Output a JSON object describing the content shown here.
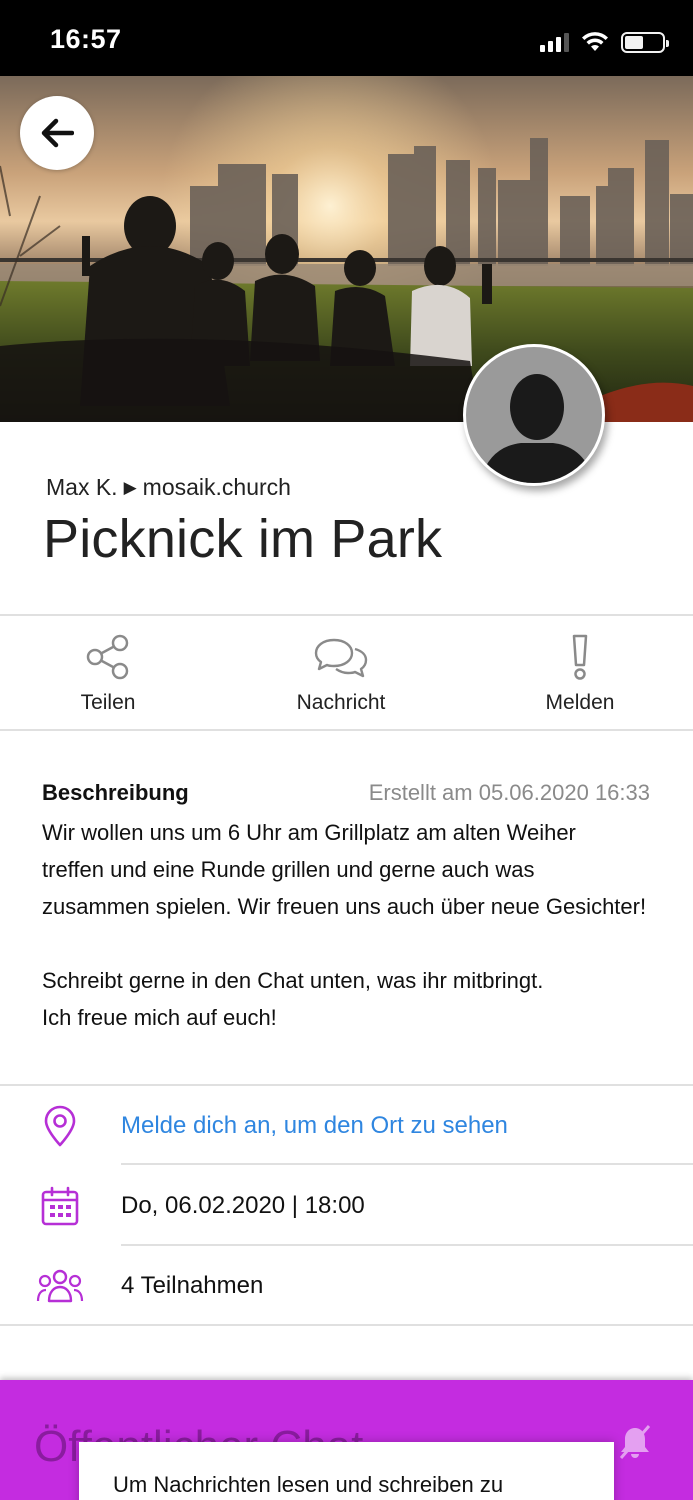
{
  "status_bar": {
    "time": "16:57"
  },
  "event": {
    "author": "Max K.",
    "community": "mosaik.church",
    "title": "Picknick im Park"
  },
  "actions": [
    {
      "label": "Teilen",
      "icon": "share-icon"
    },
    {
      "label": "Nachricht",
      "icon": "chat-bubbles-icon"
    },
    {
      "label": "Melden",
      "icon": "exclamation-icon"
    }
  ],
  "description": {
    "heading": "Beschreibung",
    "created": "Erstellt am 05.06.2020 16:33",
    "lines": [
      "Wir wollen uns um 6 Uhr am Grillplatz am alten Weiher",
      "treffen und eine Runde grillen und gerne auch was",
      "zusammen spielen. Wir freuen uns auch über neue Gesichter!",
      "",
      "Schreibt gerne in den Chat unten, was ihr mitbringt.",
      "Ich freue mich auf euch!"
    ]
  },
  "details": {
    "location": "Melde dich an, um den Ort zu sehen",
    "datetime": "Do, 06.02.2020 | 18:00",
    "participants": "4 Teilnahmen"
  },
  "chat": {
    "title": "Öffentlicher Chat",
    "login_prompt": "Um Nachrichten lesen und schreiben zu"
  },
  "colors": {
    "accent": "#c42ce0",
    "link": "#2f86e0",
    "icon": "#b62fd6"
  }
}
